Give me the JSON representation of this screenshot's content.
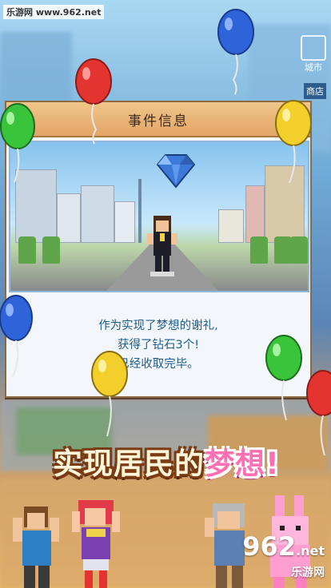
{
  "watermark_top": "乐游网 www.962.net",
  "side_buttons": [
    {
      "label": "城市"
    },
    {
      "label": "商店"
    }
  ],
  "dialog": {
    "title": "事件信息",
    "message_lines": [
      "作为实现了梦想的谢礼,",
      "获得了钻石3个!",
      "已经收取完毕。"
    ]
  },
  "banner": {
    "part1": "实现居民的",
    "part2": "梦想!"
  },
  "watermark_bottom": {
    "logo": "962",
    "suffix": ".net",
    "cn": "乐游网"
  },
  "colors": {
    "header_bg": "#e9b36f",
    "message_text": "#1f5e8a",
    "banner_pink": "#ff6fb1",
    "balloon_red": "#e3342f",
    "balloon_blue": "#2f63d9",
    "balloon_green": "#39c43b",
    "balloon_yellow": "#f2cf2b"
  },
  "icons": [
    "diamond-icon",
    "balloon-red",
    "balloon-blue",
    "balloon-green",
    "balloon-yellow"
  ]
}
